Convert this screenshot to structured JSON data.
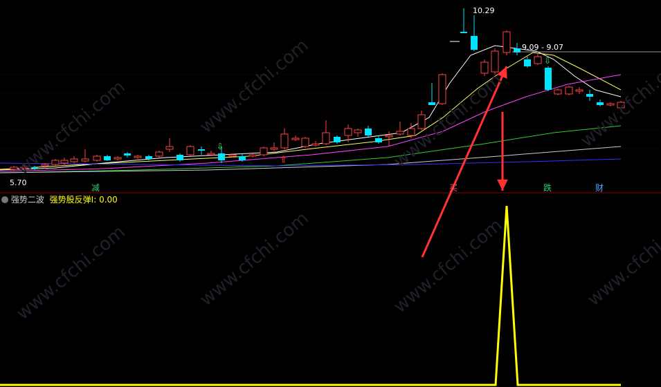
{
  "price_labels": {
    "high": "10.29",
    "range": "9.09 - 9.07",
    "low": "5.70"
  },
  "event_labels": [
    {
      "text": "减",
      "color": "#2ecc71"
    },
    {
      "text": "买",
      "color": "#ff5566"
    },
    {
      "text": "跌",
      "color": "#2ecc71"
    },
    {
      "text": "财",
      "color": "#4da6ff"
    }
  ],
  "indicator": {
    "name": "强势二波",
    "series_label": "强势股反弹I:",
    "value": "0.00"
  },
  "watermark": "www.cfchi.com",
  "colors": {
    "up": "#ff4444",
    "down": "#00e5ff",
    "indicator": "#ffff00",
    "arrow": "#ff3333"
  },
  "chart_data": {
    "type": "candlestick",
    "panels": [
      "price",
      "indicator"
    ],
    "series": [
      {
        "name": "强势股反弹I",
        "shape": "single spike",
        "current_value": 0.0
      }
    ],
    "annotations": [
      "10.29",
      "9.09 - 9.07",
      "5.70"
    ]
  }
}
